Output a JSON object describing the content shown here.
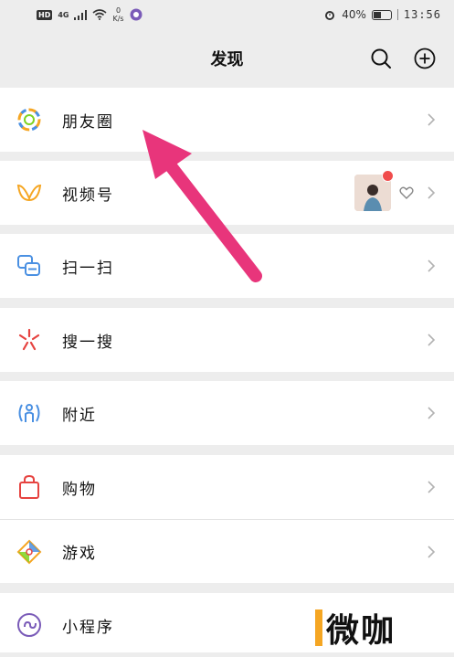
{
  "status_bar": {
    "network_badge": "HD",
    "network_type": "4G",
    "speed_value": "0",
    "speed_unit": "K/s",
    "battery": "40%",
    "time": "13:56"
  },
  "header": {
    "title": "发现"
  },
  "sections": [
    {
      "items": [
        {
          "label": "朋友圈",
          "icon": "moments-icon"
        }
      ]
    },
    {
      "items": [
        {
          "label": "视频号",
          "icon": "channels-icon"
        }
      ]
    },
    {
      "items": [
        {
          "label": "扫一扫",
          "icon": "scan-icon"
        }
      ]
    },
    {
      "items": [
        {
          "label": "搜一搜",
          "icon": "search-feature-icon"
        }
      ]
    },
    {
      "items": [
        {
          "label": "附近",
          "icon": "nearby-icon"
        }
      ]
    },
    {
      "items": [
        {
          "label": "购物",
          "icon": "shopping-bag-icon"
        },
        {
          "label": "游戏",
          "icon": "game-icon"
        }
      ]
    },
    {
      "items": [
        {
          "label": "小程序",
          "icon": "mini-program-icon"
        }
      ]
    }
  ],
  "watermark": {
    "text": "微咖"
  },
  "colors": {
    "arrow": "#e8357b",
    "background": "#ededed",
    "red_dot": "#f04c4c"
  }
}
